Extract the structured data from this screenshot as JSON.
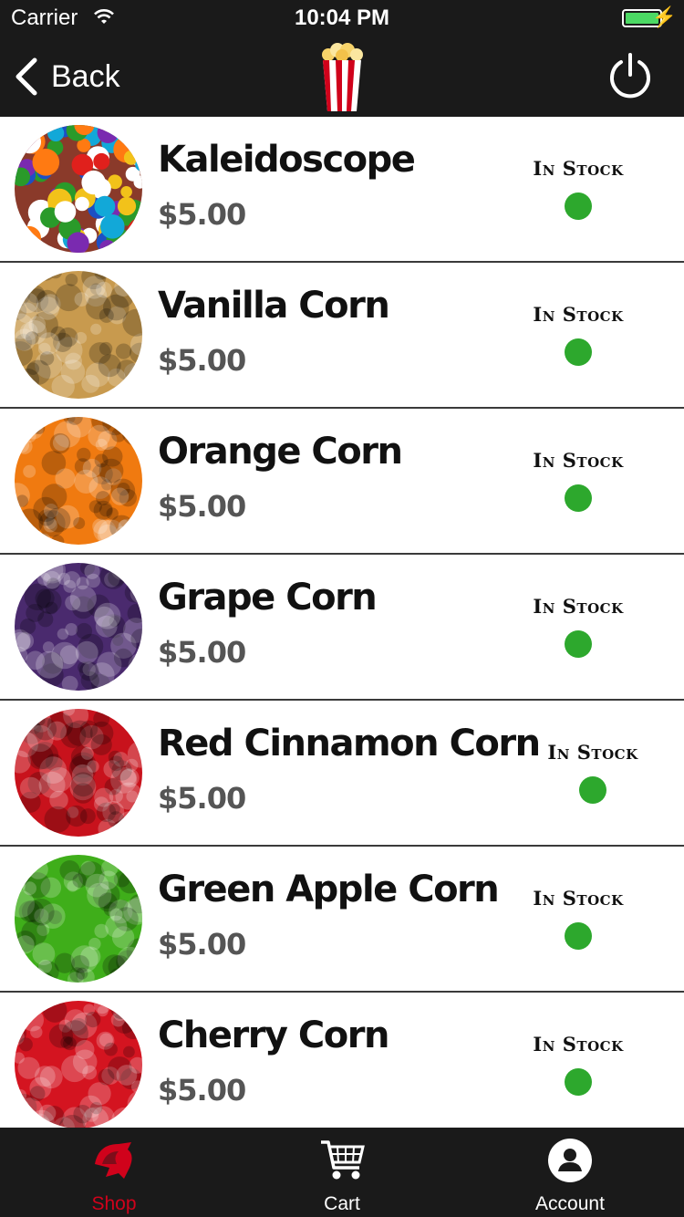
{
  "status": {
    "carrier": "Carrier",
    "time": "10:04 PM",
    "battery_level": 1.0
  },
  "nav": {
    "back_label": "Back"
  },
  "products": [
    {
      "name": "Kaleidoscope",
      "price": "$5.00",
      "stock": "In Stock",
      "swatch": "multi"
    },
    {
      "name": "Vanilla Corn",
      "price": "$5.00",
      "stock": "In Stock",
      "swatch": "#c89a4e"
    },
    {
      "name": "Orange Corn",
      "price": "$5.00",
      "stock": "In Stock",
      "swatch": "#f07a10"
    },
    {
      "name": "Grape Corn",
      "price": "$5.00",
      "stock": "In Stock",
      "swatch": "#4a2a6e"
    },
    {
      "name": "Red Cinnamon Corn",
      "price": "$5.00",
      "stock": "In Stock",
      "swatch": "#c8121c"
    },
    {
      "name": "Green Apple Corn",
      "price": "$5.00",
      "stock": "In Stock",
      "swatch": "#3fae1a"
    },
    {
      "name": "Cherry Corn",
      "price": "$5.00",
      "stock": "In Stock",
      "swatch": "#d41420"
    }
  ],
  "tabs": [
    {
      "label": "Shop",
      "icon": "shop-icon",
      "active": true
    },
    {
      "label": "Cart",
      "icon": "cart-icon",
      "active": false
    },
    {
      "label": "Account",
      "icon": "account-icon",
      "active": false
    }
  ],
  "colors": {
    "accent": "#d0021b",
    "in_stock": "#2da82d",
    "bar": "#1a1a1a"
  }
}
